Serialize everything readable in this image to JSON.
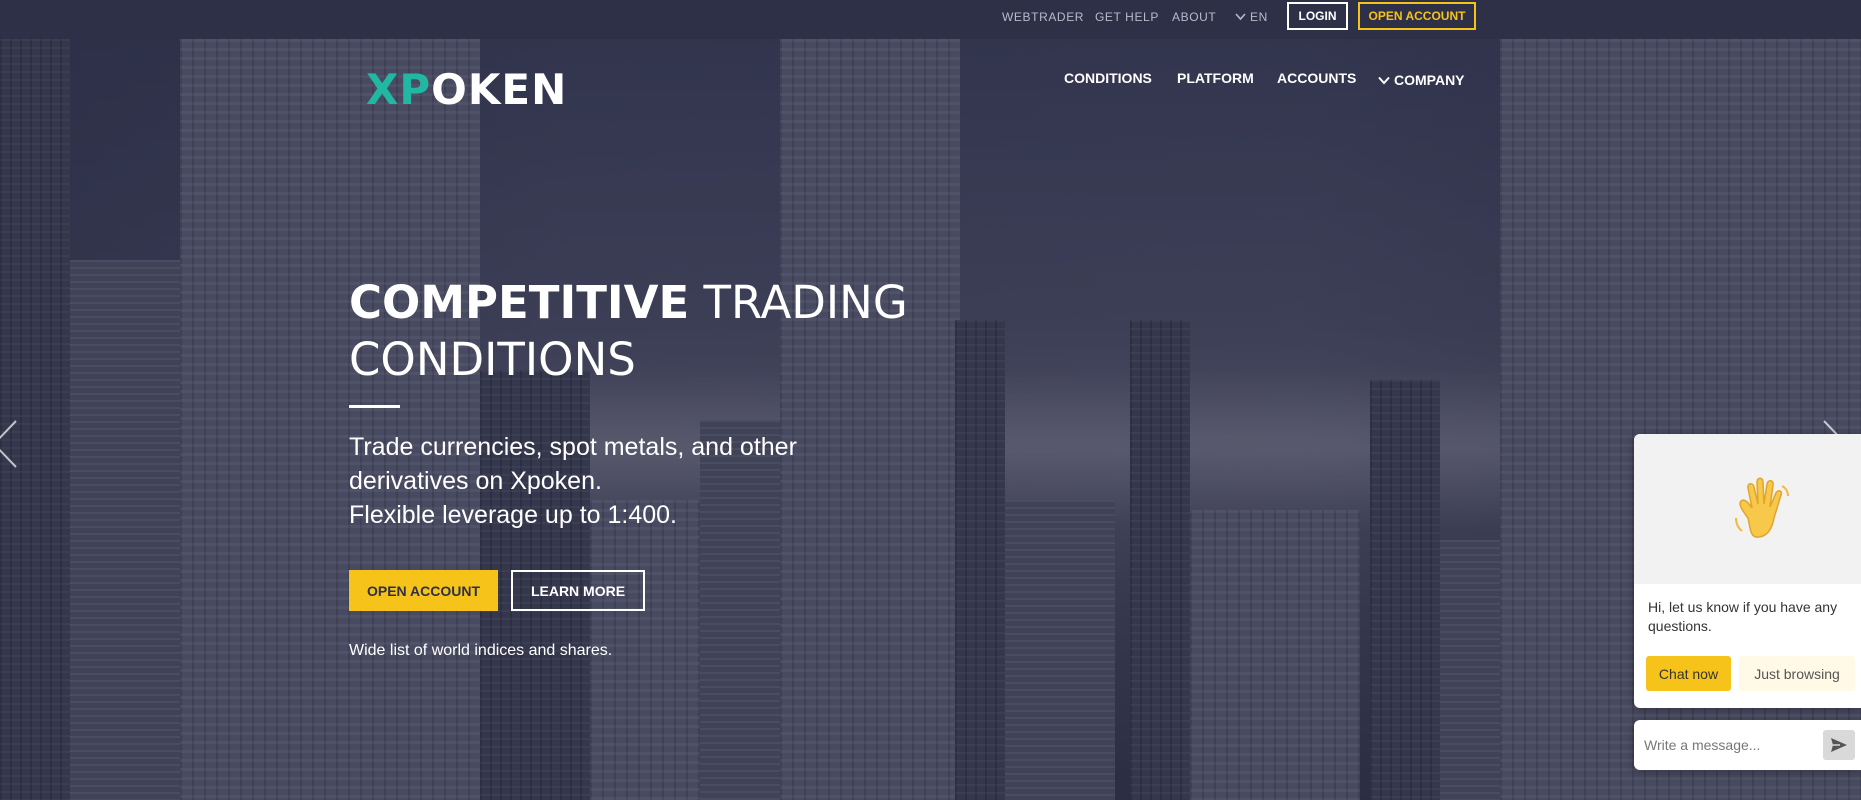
{
  "topbar": {
    "links": {
      "webtrader": "WEBTRADER",
      "get_help": "GET HELP",
      "about": "ABOUT",
      "language": "EN"
    },
    "login_label": "LOGIN",
    "open_account_label": "OPEN ACCOUNT"
  },
  "brand": {
    "logo_accent": "XP",
    "logo_rest": "OKEN",
    "accent_color": "#22b7a2"
  },
  "nav": {
    "conditions": "CONDITIONS",
    "platform": "PLATFORM",
    "accounts": "ACCOUNTS",
    "company": "COMPANY"
  },
  "hero": {
    "title_bold": "COMPETITIVE",
    "title_light_1": "TRADING",
    "title_light_2": "CONDITIONS",
    "subtitle_lines": [
      "Trade currencies, spot metals, and other",
      "derivatives on Xpoken.",
      "Flexible leverage up to 1:400."
    ],
    "open_account_label": "OPEN ACCOUNT",
    "learn_more_label": "LEARN MORE",
    "note": "Wide list of world indices and shares."
  },
  "chat": {
    "message": "Hi, let us know if you have any questions.",
    "chat_now_label": "Chat now",
    "just_browsing_label": "Just browsing",
    "input_placeholder": "Write a message..."
  },
  "colors": {
    "topbar_bg": "#2d3047",
    "button_yellow": "#f6c31a",
    "text_white": "#ffffff"
  },
  "icons": [
    "chevron-down-icon",
    "chevron-left-icon",
    "chevron-right-icon",
    "waving-hand-icon",
    "send-icon"
  ]
}
